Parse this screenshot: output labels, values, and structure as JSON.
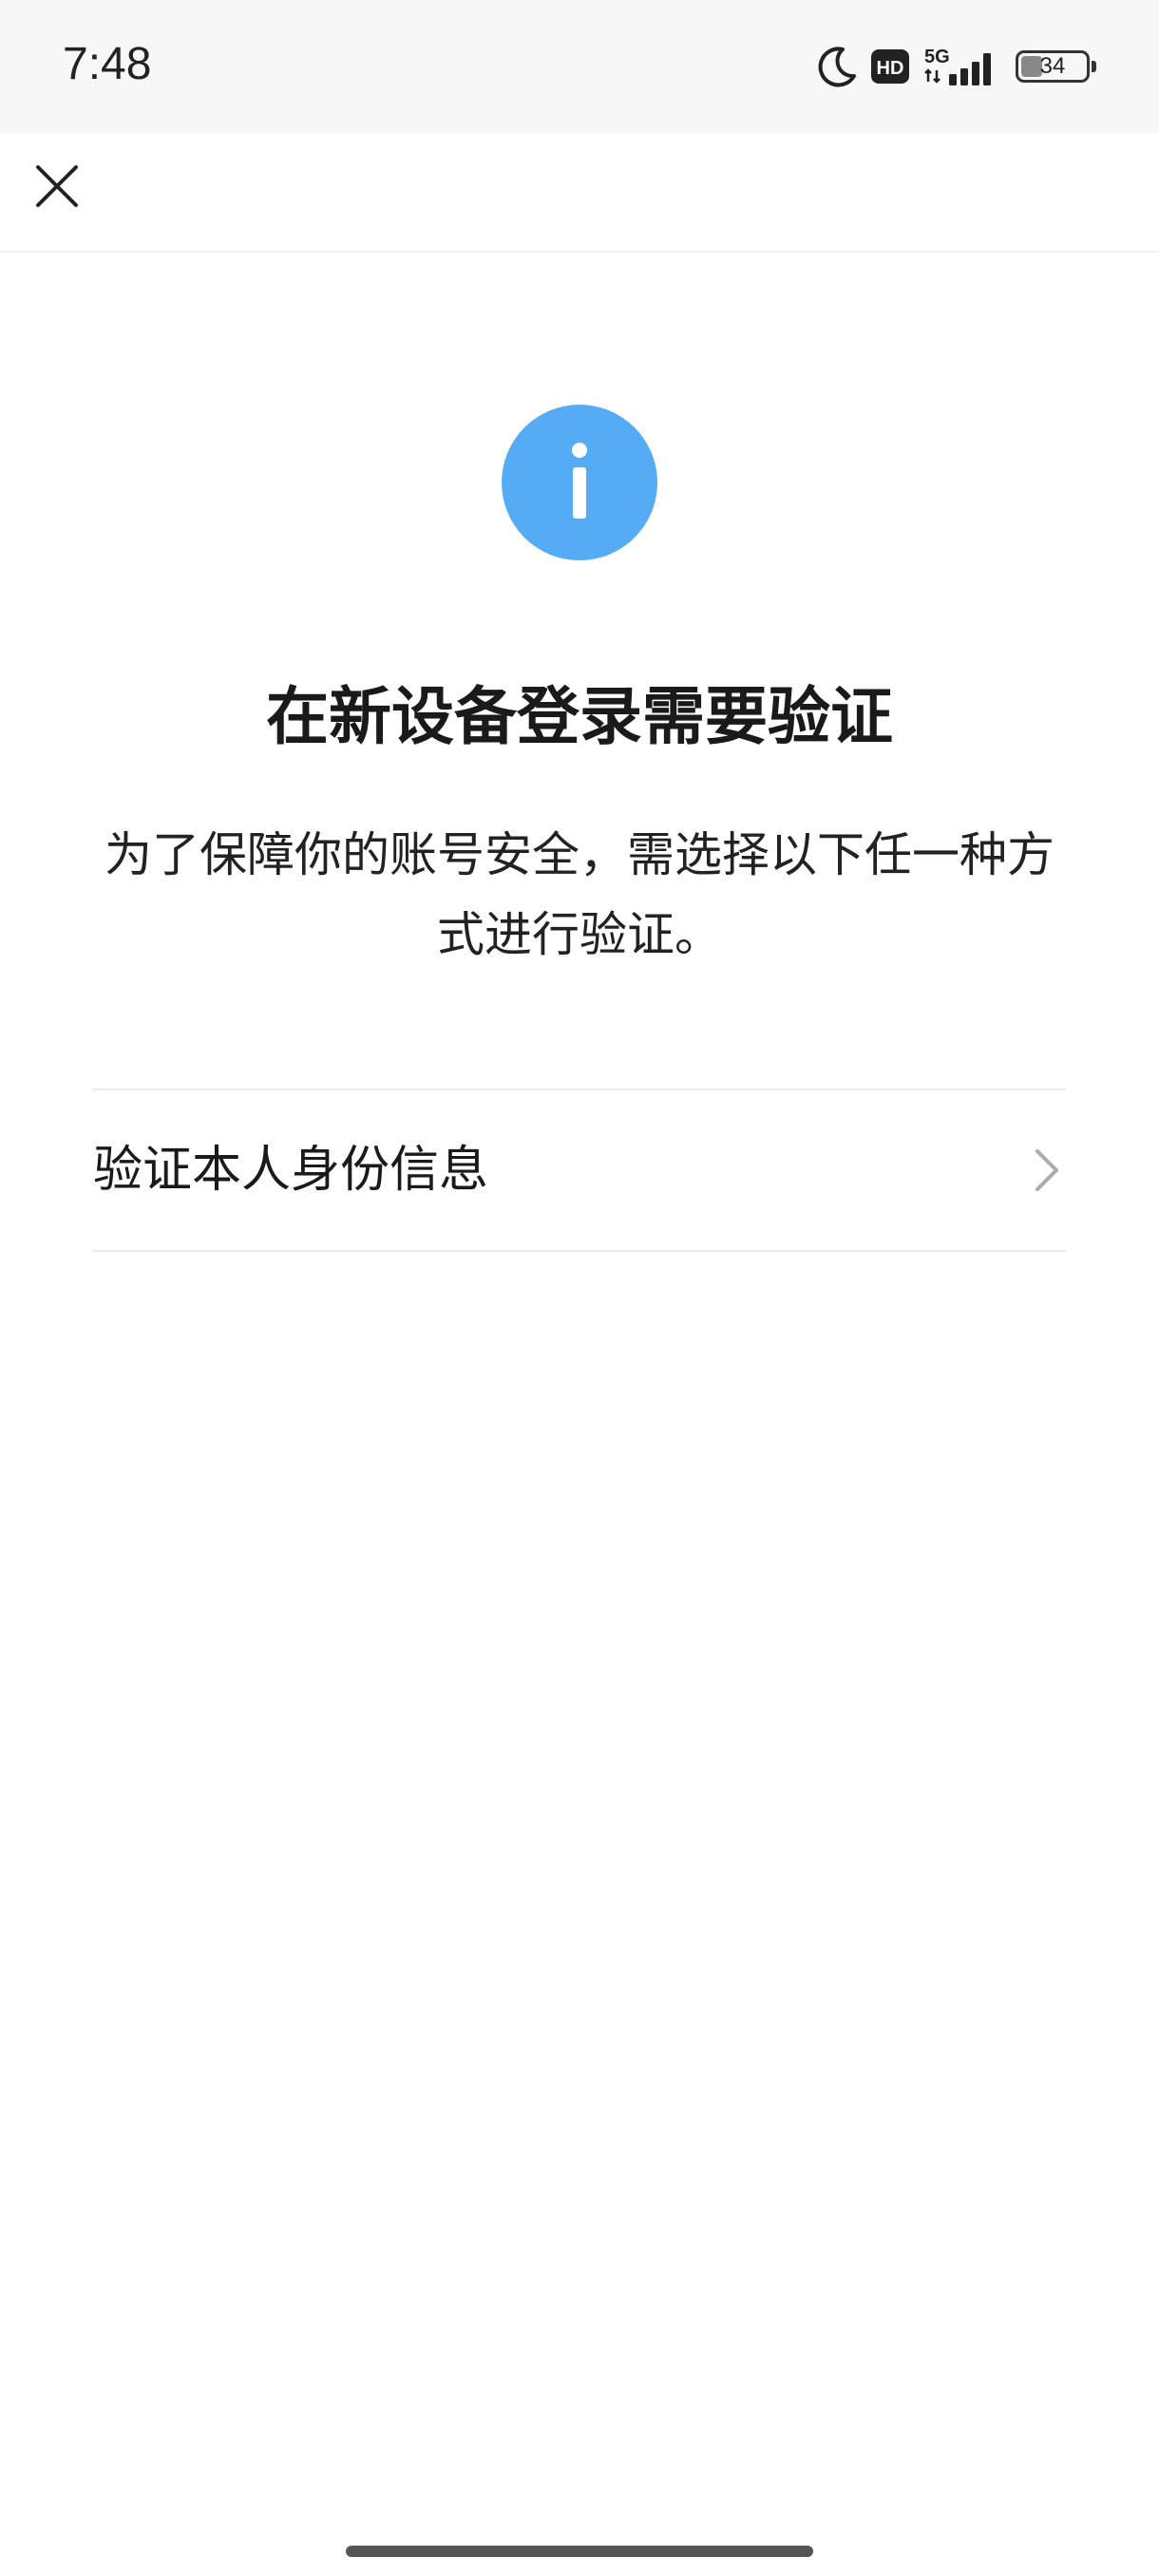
{
  "status_bar": {
    "time": "7:48",
    "network": "5G",
    "hd_badge": "HD",
    "battery_level": "34",
    "battery_fraction": 0.34,
    "icons": [
      "moon-icon",
      "hd-icon",
      "signal-5g-icon",
      "battery-icon"
    ]
  },
  "top_bar": {
    "close_icon": "close-icon"
  },
  "main": {
    "info_icon": "info-icon",
    "info_icon_color": "#55acf5",
    "title": "在新设备登录需要验证",
    "description": "为了保障你的账号安全，需选择以下任一种方式进行验证。",
    "options": [
      {
        "label": "验证本人身份信息",
        "icon": "chevron-right-icon"
      }
    ]
  }
}
